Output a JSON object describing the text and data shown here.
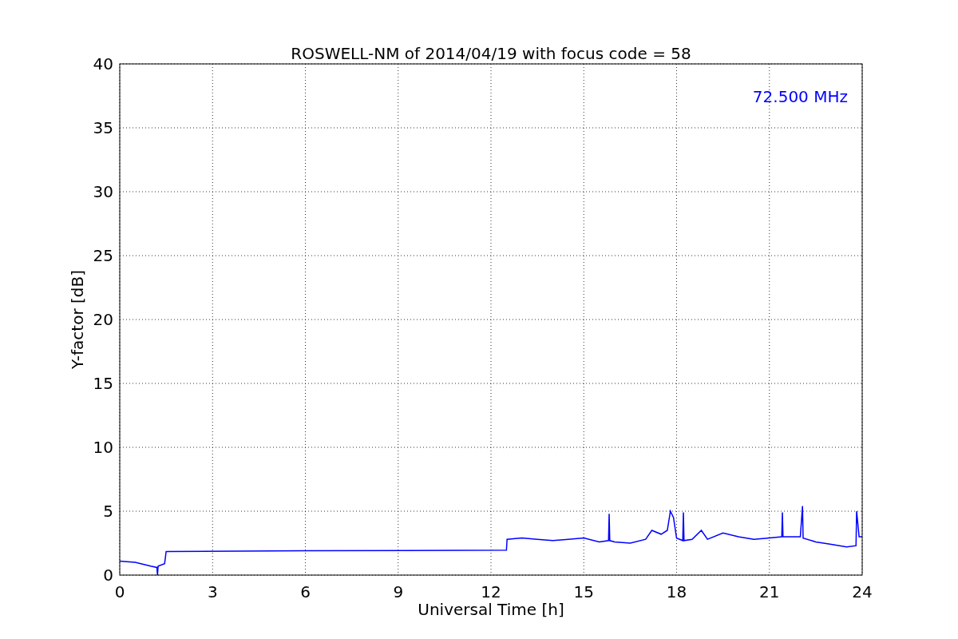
{
  "chart_data": {
    "type": "line",
    "title": "ROSWELL-NM of 2014/04/19 with focus code = 58",
    "xlabel": "Universal Time [h]",
    "ylabel": "Y-factor [dB]",
    "x": [
      0,
      0.5,
      1.0,
      1.2,
      1.22,
      1.24,
      1.45,
      1.5,
      6,
      12.5,
      12.52,
      13,
      13.5,
      14,
      14.5,
      15,
      15.5,
      15.8,
      15.82,
      15.84,
      16,
      16.5,
      17,
      17.2,
      17.5,
      17.7,
      17.8,
      17.9,
      18,
      18.2,
      18.22,
      18.24,
      18.5,
      18.8,
      19,
      19.5,
      20,
      20.5,
      21,
      21.4,
      21.42,
      21.44,
      22,
      22.07,
      22.09,
      22.5,
      23,
      23.5,
      23.8,
      23.82,
      23.9,
      24
    ],
    "series": [
      {
        "name": "72.500 MHz",
        "color": "#0000ff",
        "values": [
          1.1,
          1.0,
          0.7,
          0.6,
          0.0,
          0.7,
          0.9,
          1.85,
          1.9,
          1.95,
          2.8,
          2.9,
          2.8,
          2.7,
          2.8,
          2.9,
          2.6,
          2.7,
          4.8,
          2.7,
          2.6,
          2.5,
          2.8,
          3.5,
          3.2,
          3.5,
          5.0,
          4.5,
          2.9,
          2.7,
          4.9,
          2.7,
          2.8,
          3.5,
          2.8,
          3.3,
          3.0,
          2.8,
          2.9,
          3.0,
          4.9,
          3.0,
          3.0,
          5.4,
          2.9,
          2.6,
          2.4,
          2.2,
          2.3,
          5.0,
          3.0,
          3.0
        ]
      }
    ],
    "xlim": [
      0,
      24
    ],
    "ylim": [
      0,
      40
    ],
    "xticks": [
      0,
      3,
      6,
      9,
      12,
      15,
      18,
      21,
      24
    ],
    "yticks": [
      0,
      5,
      10,
      15,
      20,
      25,
      30,
      35,
      40
    ],
    "grid": true
  }
}
